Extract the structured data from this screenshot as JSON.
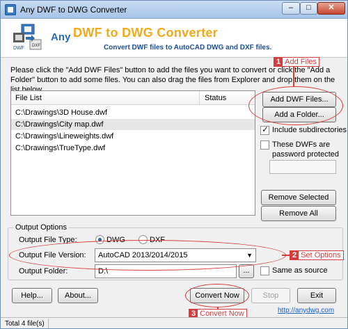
{
  "window": {
    "title": "Any DWF to DWG Converter"
  },
  "titlebar_buttons": {
    "minimize": "–",
    "maximize": "□",
    "close": "✕"
  },
  "header": {
    "brand_prefix": "Any",
    "brand_title": "DWF to DWG Converter",
    "brand_subtitle": "Convert DWF files to AutoCAD DWG and DXF files.",
    "logo_label": "DWF",
    "logo_tag": "DXF"
  },
  "instructions": "Please click the \"Add DWF Files\" button to add the files you want to convert or click the \"Add a Folder\" button to add some files. You can also drag the files from Explorer and drop them on the list below.",
  "file_list": {
    "columns": [
      "File List",
      "Status"
    ],
    "rows": [
      "C:\\Drawings\\3D House.dwf",
      "C:\\Drawings\\City map.dwf",
      "C:\\Drawings\\Lineweights.dwf",
      "C:\\Drawings\\TrueType.dwf"
    ]
  },
  "side": {
    "add_files": "Add DWF Files...",
    "add_folder": "Add a Folder...",
    "include_subdirs": "Include subdirectories",
    "password_line1": "These DWFs are",
    "password_line2": "password protected",
    "remove_selected": "Remove Selected",
    "remove_all": "Remove All"
  },
  "output": {
    "group_title": "Output Options",
    "type_label": "Output File Type:",
    "type_dwg": "DWG",
    "type_dxf": "DXF",
    "version_label": "Output File Version:",
    "version_value": "AutoCAD 2013/2014/2015",
    "folder_label": "Output Folder:",
    "folder_value": "D:\\",
    "browse": "...",
    "same_as_source": "Same as source"
  },
  "bottom": {
    "help": "Help...",
    "about": "About...",
    "convert": "Convert Now",
    "stop": "Stop",
    "exit": "Exit",
    "link": "http://anydwg.com"
  },
  "callouts": {
    "c1_num": "1",
    "c1_text": "Add Files",
    "c2_num": "2",
    "c2_text": "Set Options",
    "c3_num": "3",
    "c3_text": "Convert Now"
  },
  "status": {
    "text": "Total 4 file(s)"
  },
  "colors": {
    "annotation": "#d63c3c",
    "brand_orange": "#f4a91a",
    "brand_blue": "#1c4f98"
  }
}
